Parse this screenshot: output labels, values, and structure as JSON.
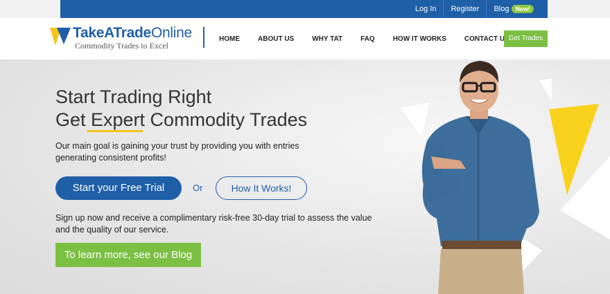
{
  "topbar": {
    "login": "Log In",
    "register": "Register",
    "blog": "Blog",
    "blog_badge": "New!"
  },
  "brand": {
    "name_part1": "TakeATrade",
    "name_part2": "Online",
    "tagline": "Commodity Trades to Excel"
  },
  "nav": {
    "items": [
      "HOME",
      "ABOUT US",
      "WHY TAT",
      "FAQ",
      "HOW IT WORKS",
      "CONTACT US"
    ],
    "cta": "Get Trades"
  },
  "hero": {
    "headline_line1": "Start Trading Right",
    "headline_line2": "Get Expert Commodity Trades",
    "description": "Our main goal is gaining your trust by providing you with entries generating consistent profits!",
    "primary_button": "Start your Free Trial",
    "or_text": "Or",
    "secondary_button": "How It Works!",
    "signup_text": "Sign up now and receive a complimentary risk-free 30-day trial to assess the value and the quality of our service.",
    "blog_button": "To learn more, see our Blog"
  },
  "colors": {
    "brand_blue": "#1f5fa8",
    "green": "#7bc043",
    "accent_yellow": "#f5c518"
  }
}
